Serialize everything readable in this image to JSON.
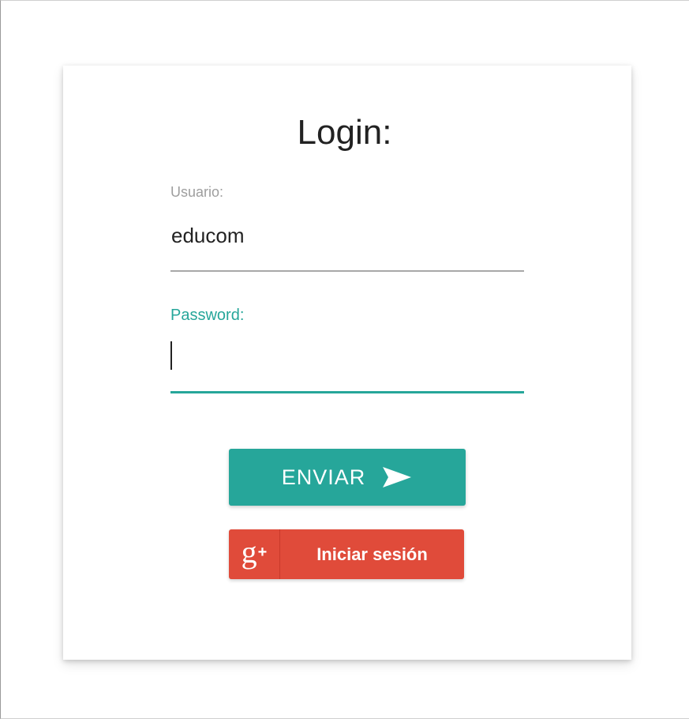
{
  "login": {
    "title": "Login:",
    "username": {
      "label": "Usuario:",
      "value": "educom"
    },
    "password": {
      "label": "Password:",
      "value": ""
    },
    "send_button": {
      "label": "ENVIAR",
      "icon": "send-icon"
    },
    "google_button": {
      "icon": "google-plus-icon",
      "icon_text": "g",
      "icon_plus": "+",
      "label": "Iniciar sesión"
    }
  },
  "colors": {
    "accent": "#26a69a",
    "google": "#e04b3a",
    "label_gray": "#9e9e9e",
    "text": "#222222"
  }
}
